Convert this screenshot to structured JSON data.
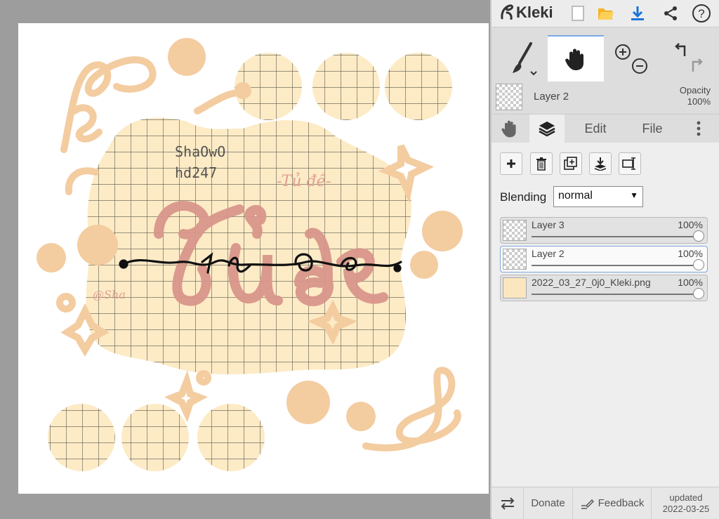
{
  "app": {
    "name": "Kleki"
  },
  "canvas": {
    "texts": {
      "credit_line1": "ShaOwO",
      "credit_line2": "hd247",
      "small_title": "-Tủ đề-",
      "big_title": "Tủ đề",
      "script_title": "tủ đè",
      "signature": "@Sha"
    },
    "colors": {
      "grid_fill": "#fdebc6",
      "grid_line": "#5a5a4e",
      "blob": "#f3cca0",
      "title": "#d9968a",
      "ink": "#111111"
    }
  },
  "toolbar": {
    "icons": [
      "new-image-icon",
      "open-folder-icon",
      "download-icon",
      "share-icon",
      "help-icon"
    ],
    "tools": [
      "brush-icon",
      "hand-icon",
      "zoom-in-icon",
      "zoom-out-icon",
      "undo-icon",
      "redo-icon"
    ]
  },
  "layer_info": {
    "name": "Layer 2",
    "opacity_label": "Opacity",
    "opacity_value": "100%"
  },
  "tabs": {
    "edit": "Edit",
    "file": "File"
  },
  "layers_panel": {
    "blending_label": "Blending",
    "blending_value": "normal",
    "layers": [
      {
        "name": "Layer 3",
        "opacity": "100%",
        "selected": false
      },
      {
        "name": "Layer 2",
        "opacity": "100%",
        "selected": true
      },
      {
        "name": "2022_03_27_0j0_Kleki.png",
        "opacity": "100%",
        "selected": false
      }
    ]
  },
  "footer": {
    "donate": "Donate",
    "feedback": "Feedback",
    "updated_label": "updated",
    "updated_date": "2022-03-25"
  }
}
